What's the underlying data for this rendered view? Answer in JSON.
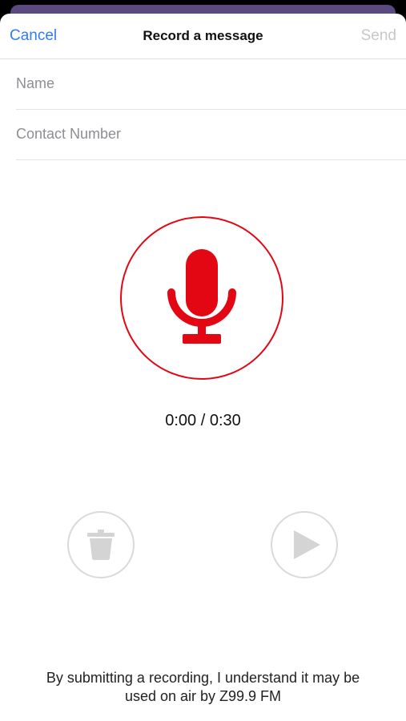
{
  "nav": {
    "cancel_label": "Cancel",
    "title": "Record a message",
    "send_label": "Send"
  },
  "form": {
    "name_placeholder": "Name",
    "name_value": "",
    "contact_placeholder": "Contact Number",
    "contact_value": ""
  },
  "recorder": {
    "elapsed": "0:00",
    "separator": " / ",
    "duration": "0:30"
  },
  "icons": {
    "record": "microphone-icon",
    "delete": "trash-icon",
    "play": "play-icon"
  },
  "colors": {
    "accent_blue": "#2f7cf6",
    "record_red": "#e30613",
    "disabled_gray": "#c7c7cc",
    "control_gray": "#dadada"
  },
  "disclaimer": {
    "line1": "By submitting a recording, I understand it may be",
    "line2": "used on air by Z99.9 FM"
  }
}
